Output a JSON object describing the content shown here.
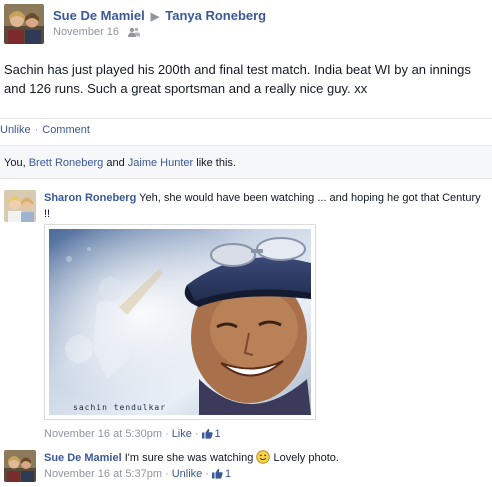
{
  "post": {
    "author": "Sue De Mamiel",
    "recipient": "Tanya Roneberg",
    "date": "November 16",
    "text": "Sachin has just played his 200th and final test match. India beat WI by an innings and 126 runs. Such a great sportsman and a really nice guy. xx",
    "actions": {
      "unlike": "Unlike",
      "comment": "Comment"
    },
    "likes": {
      "prefix": "You, ",
      "person1": "Brett Roneberg",
      "and": " and ",
      "person2": "Jaime Hunter",
      "suffix": " like this."
    }
  },
  "comments": [
    {
      "author": "Sharon Roneberg",
      "text": "Yeh, she would have been watching ... and hoping he got that Century !!",
      "photo_caption": "sachin tendulkar",
      "time": "November 16 at 5:30pm",
      "like_label": "Like",
      "like_count": "1"
    },
    {
      "author": "Sue De Mamiel",
      "text_before": "I'm sure she was watching",
      "text_after": "Lovely photo.",
      "time": "November 16 at 5:37pm",
      "like_label": "Unlike",
      "like_count": "1"
    }
  ],
  "colors": {
    "link": "#3b5998",
    "muted": "#90949c",
    "likes_bg": "#f6f7f9"
  },
  "icons": {
    "audience": "group-icon",
    "thumb": "thumbs-up-icon",
    "smiley": "smiley-icon"
  }
}
